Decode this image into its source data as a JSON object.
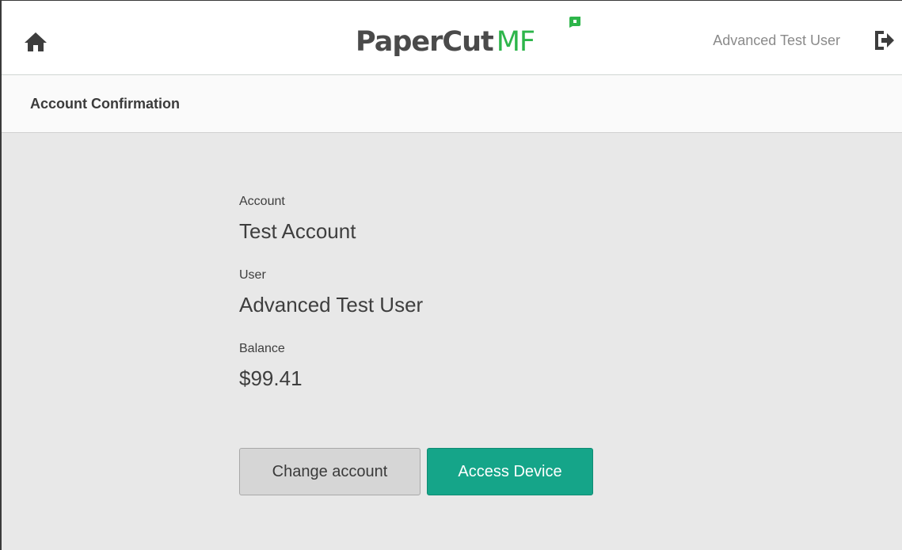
{
  "header": {
    "home_icon": "home-icon",
    "logo": {
      "part1": "PaperCut",
      "part2": "MF"
    },
    "username": "Advanced Test User",
    "logout_icon": "logout-icon"
  },
  "page": {
    "title": "Account Confirmation"
  },
  "details": {
    "account_label": "Account",
    "account_value": "Test Account",
    "user_label": "User",
    "user_value": "Advanced Test User",
    "balance_label": "Balance",
    "balance_value": "$99.41"
  },
  "actions": {
    "change_account_label": "Change account",
    "access_device_label": "Access Device"
  },
  "colors": {
    "brand_green": "#2db54a",
    "primary_button": "#15a589",
    "background": "#e8e8e8"
  }
}
